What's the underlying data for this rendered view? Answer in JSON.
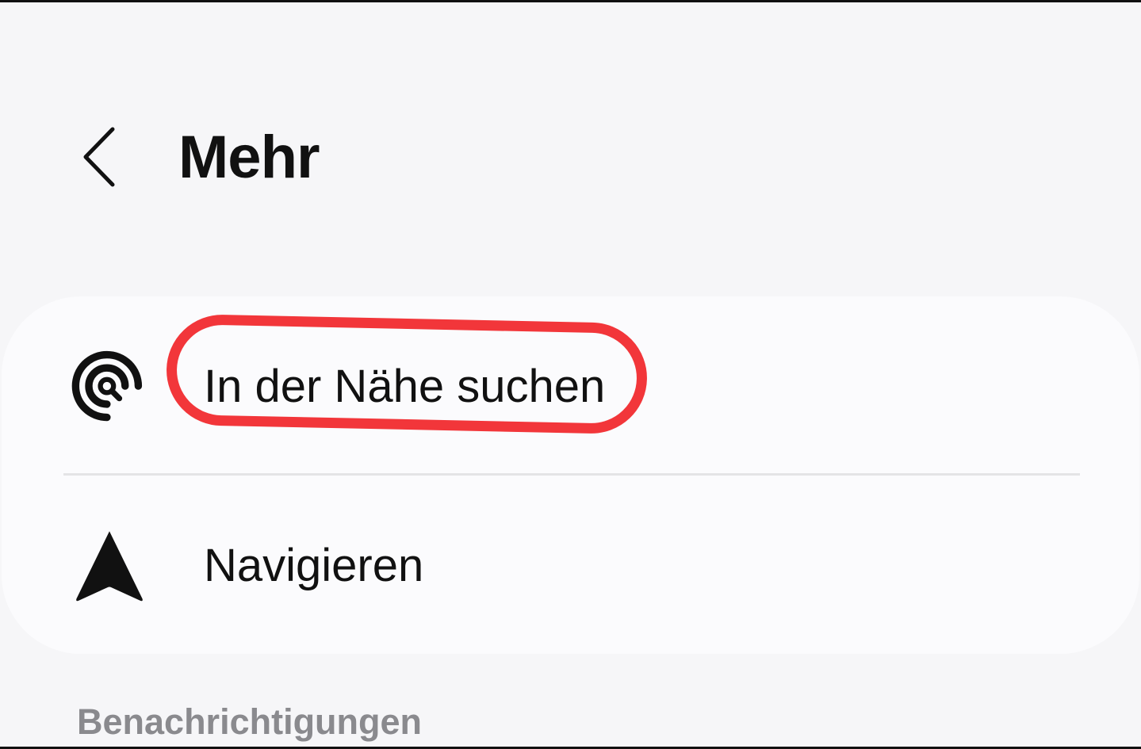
{
  "header": {
    "back_icon": "chevron-left-icon",
    "title": "Mehr"
  },
  "menu": {
    "items": [
      {
        "label": "In der Nähe suchen",
        "icon": "nearby-search-icon",
        "highlighted": true,
        "highlight_color": "#f2363a"
      },
      {
        "label": "Navigieren",
        "icon": "navigation-arrow-icon",
        "highlighted": false
      }
    ]
  },
  "section": {
    "header": "Benachrichtigungen"
  },
  "colors": {
    "background": "#f6f6f8",
    "card": "#fbfbfd",
    "text": "#111111",
    "section_header": "#8a8a8e",
    "highlight": "#f2363a"
  }
}
